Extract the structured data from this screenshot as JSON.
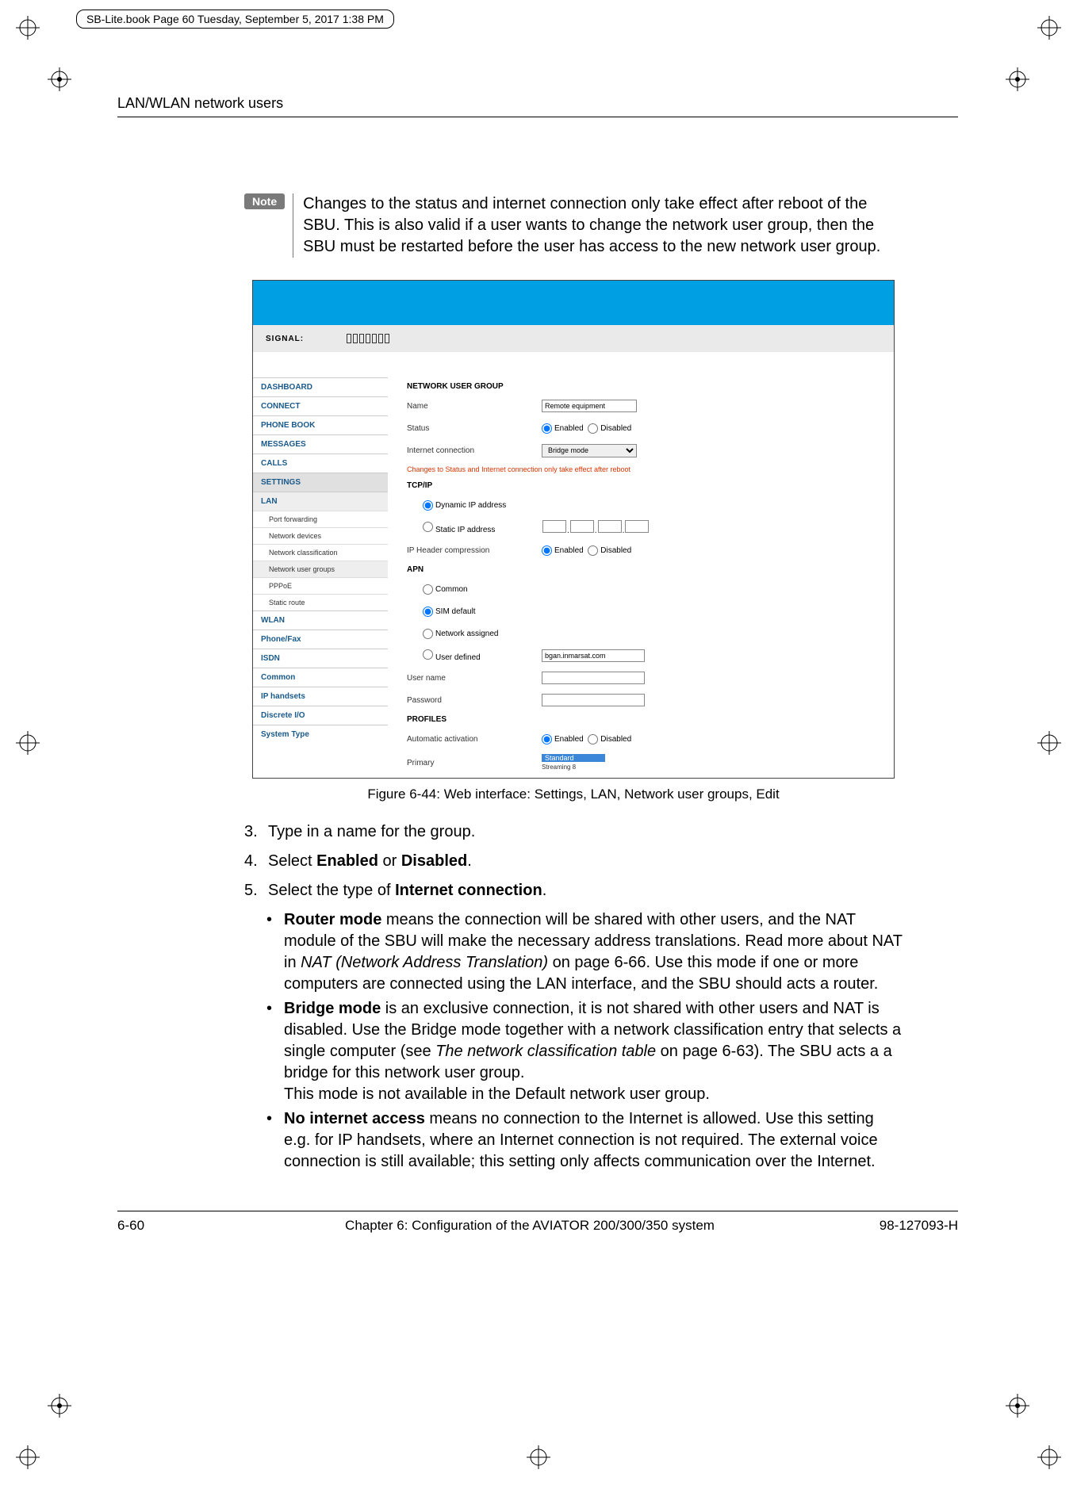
{
  "book_tag": "SB-Lite.book  Page 60  Tuesday, September 5, 2017  1:38 PM",
  "running_head": "LAN/WLAN network users",
  "note": {
    "badge": "Note",
    "text": "Changes to the status and internet connection only take effect after reboot of the SBU. This is also valid if a user wants to change the network user group, then the SBU must be restarted before the user has access to the new network user group."
  },
  "screenshot": {
    "signal_label": "SIGNAL:",
    "nav": {
      "dashboard": "DASHBOARD",
      "connect": "CONNECT",
      "phonebook": "PHONE BOOK",
      "messages": "MESSAGES",
      "calls": "CALLS",
      "settings": "SETTINGS",
      "lan": "LAN",
      "portfwd": "Port forwarding",
      "netdev": "Network devices",
      "netclass": "Network classification",
      "netuser": "Network user groups",
      "pppoe": "PPPoE",
      "static": "Static route",
      "wlan": "WLAN",
      "phonefax": "Phone/Fax",
      "isdn": "ISDN",
      "common": "Common",
      "iphand": "IP handsets",
      "discrete": "Discrete I/O",
      "systype": "System Type"
    },
    "content": {
      "h_nug": "NETWORK USER GROUP",
      "name_label": "Name",
      "name_value": "Remote equipment",
      "status_label": "Status",
      "enabled": "Enabled",
      "disabled": "Disabled",
      "inet_label": "Internet connection",
      "inet_value": "Bridge mode",
      "warn": "Changes to Status and Internet connection only take effect after reboot",
      "h_tcpip": "TCP/IP",
      "dynip": "Dynamic IP address",
      "staticip": "Static IP address",
      "iphdr": "IP Header compression",
      "h_apn": "APN",
      "apn_common": "Common",
      "apn_sim": "SIM default",
      "apn_net": "Network assigned",
      "apn_user": "User defined",
      "apn_user_val": "bgan.inmarsat.com",
      "username": "User name",
      "password": "Password",
      "h_profiles": "PROFILES",
      "auto_act": "Automatic activation",
      "primary": "Primary",
      "primary_sel": "Standard",
      "primary_sub": "Streaming 8"
    }
  },
  "figure_caption": "Figure 6-44: Web interface: Settings, LAN, Network user groups, Edit",
  "steps": {
    "s3": "Type in a name for the group.",
    "s4_a": "Select ",
    "s4_b": "Enabled",
    "s4_c": " or ",
    "s4_d": "Disabled",
    "s4_e": ".",
    "s5_a": "Select the type of ",
    "s5_b": "Internet connection",
    "s5_c": ".",
    "b1_a": "Router mode",
    "b1_b": " means the connection will be shared with other users, and the NAT module of the SBU will make the necessary address translations. Read more about NAT in ",
    "b1_c": "NAT (Network Address Translation)",
    "b1_d": " on page 6-66. Use this mode if one or more computers are connected using the LAN interface, and the SBU should acts a router.",
    "b2_a": "Bridge mode",
    "b2_b": " is an exclusive connection, it is not shared with other users and NAT is disabled. Use the Bridge mode together with a network classification entry that selects a single computer (see ",
    "b2_c": "The network classification table",
    "b2_d": " on page 6-63). The SBU acts a a bridge for this network user group.",
    "b2_e": "This mode is not available in the Default network user group.",
    "b3_a": "No internet access",
    "b3_b": " means no connection to the Internet is allowed. Use this setting e.g. for IP handsets, where an Internet connection is not required. The external voice connection is still available; this setting only affects communication over the Internet."
  },
  "footer": {
    "page": "6-60",
    "chapter": "Chapter 6:  Configuration of the AVIATOR 200/300/350 system",
    "docnum": "98-127093-H"
  }
}
